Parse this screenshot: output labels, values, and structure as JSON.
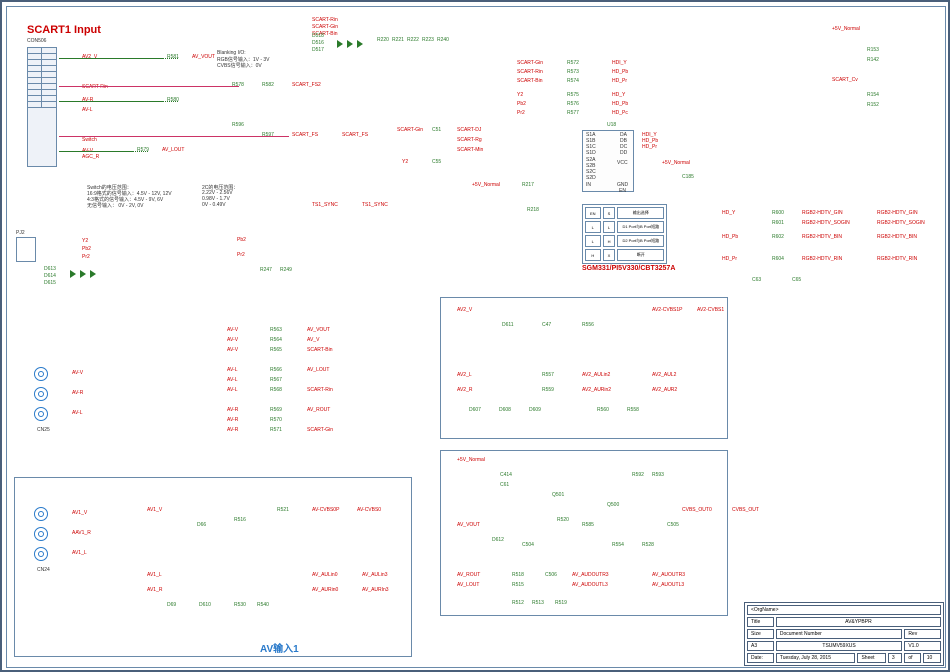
{
  "title": {
    "main": "SCART1 Input",
    "av_input": "AV输入1",
    "chip": "SGM331/PI5V330/CBT3257A"
  },
  "connectors": {
    "scart": "CON506",
    "rca_upper": "CN25",
    "rca_lower": "CN24",
    "pj2": "PJ2"
  },
  "notes": {
    "blanking": "Blanking I/O:",
    "blanking1": "RGB信号输入：1V - 3V",
    "blanking2": "CVBS信号输入：0V",
    "switch_title": "Switch的电压范围：",
    "switch1": "16:9格式的信号输入：4.5V - 12V, 12V",
    "switch2": "4:3格式的信号输入：4.5V - 9V, 6V",
    "switch3": "无信号输入：        0V - 2V, 0V",
    "vc_title": "2C的电压范围：",
    "vc1": "2.22V - 2.56V",
    "vc2": "0.98V - 1.7V",
    "vc3": "0V - 0.49V"
  },
  "nets": {
    "av2_v": "AV2_V",
    "scart_rin": "SCART-Rin",
    "av_vout": "AV_VOUT",
    "av_r": "AV-R",
    "av_l": "AV-L",
    "av_v": "AV-V",
    "switch": "Switch",
    "agc_r": "AGC_R",
    "av_lout": "AV_LOUT",
    "scart_gin": "SCART-Gin",
    "scart_bin": "SCART-Bin",
    "scart_fs2": "SCART_FS2",
    "scart_fs": "SCART_FS",
    "scart_dj": "SCART-DJ",
    "scart_rg": "SCART-Rg",
    "scart_min": "SCART-Min",
    "ts1_sync": "TS1_SYNC",
    "y2": "Y2",
    "pb2": "Pb2",
    "pr2": "Pr2",
    "hd_y": "HD_Y",
    "hd_pb": "HD_Pb",
    "hd_pr": "HD_Pr",
    "hd_pc": "HD_Pc",
    "hdi_y": "HDI_Y",
    "hdi_pb": "HDI_Pb",
    "hdi_pr": "HDI_Pr",
    "plus5v": "+5V_Normal",
    "plus5vn": "+5V_Normal",
    "scart_cv": "SCART_Cv",
    "rgb2_hdtv_gin": "RGB2-HDTV_GIN",
    "rgb2_hdtv_sogin": "RGB2-HDTV_SOGIN",
    "rgb2_hdtv_bin": "RGB2-HDTV_BIN",
    "rgb2_hdtv_rin": "RGB2-HDTV_RIN",
    "av2_cvbs1p": "AV2-CVBS1P",
    "av2_cvbs1": "AV2-CVBS1",
    "av2_aulin2": "AV2_AULin2",
    "av2_aurin2": "AV2_AURin2",
    "av2_aul2": "AV2_AUL2",
    "av2_aur2": "AV2_AUR2",
    "av2_l": "AV2_L",
    "av2_r": "AV2_R",
    "av_cvbs0p": "AV-CVBS0P",
    "av_cvbs0": "AV-CVBS0",
    "av1_v": "AV1_V",
    "aav1_r": "AAV1_R",
    "av1_l": "AV1_L",
    "av1_r": "AV1_R",
    "av_aulin0": "AV_AULin0",
    "av_aurin0": "AV_AURin0",
    "av_aulin3": "AV_AULin3",
    "av_aurin3": "AV_AURIn3",
    "av_rout": "AV_ROUT",
    "av_audoutr3": "AV_AUDOUTR3",
    "av_audoutl3": "AV_AUDOUTL3",
    "av_auoutr3": "AV_AUOUTR3",
    "av_auoutl3": "AV_AUOUTL3",
    "cvbs_out0": "CVBS_OUT0",
    "cvbs_out": "CVBS_OUT"
  },
  "components": {
    "r581": "R581",
    "r580": "R580",
    "r579": "R579",
    "r578": "R578",
    "r582": "R582",
    "r596": "R596",
    "r597": "R597",
    "r572": "R572",
    "r573": "R573",
    "r574": "R574",
    "r575": "R575",
    "r576": "R576",
    "r577": "R577",
    "r153": "R153",
    "r142": "R142",
    "r154": "R154",
    "r152": "R152",
    "r217": "R217",
    "r218": "R218",
    "r586": "R586",
    "r600": "R600",
    "r601": "R601",
    "r602": "R602",
    "r604": "R604",
    "r220": "R220",
    "r221": "R221",
    "r222": "R222",
    "r223": "R223",
    "r240": "R240",
    "r247": "R247",
    "r249": "R249",
    "r556": "R556",
    "r557": "R557",
    "r559": "R559",
    "r560": "R560",
    "r558": "R558",
    "r540": "R540",
    "r520": "R520",
    "r505": "R505",
    "r585": "R585",
    "r521": "R521",
    "r516": "R516",
    "r530": "R530",
    "r563": "R563",
    "r564": "R564",
    "r565": "R565",
    "r566": "R566",
    "r567": "R567",
    "r568": "R568",
    "r569": "R569",
    "r570": "R570",
    "r571": "R571",
    "r592": "R592",
    "r593": "R593",
    "r528": "R528",
    "r554": "R554",
    "r512": "R512",
    "r513": "R513",
    "r515": "R515",
    "r518": "R518",
    "r519": "R519",
    "d516": "D516",
    "d517": "D517",
    "d518": "D518",
    "d611": "D611",
    "d607": "D607",
    "d608": "D608",
    "d609": "D609",
    "d613": "D613",
    "d614": "D614",
    "d615": "D615",
    "d66": "D66",
    "d610": "D610",
    "d69": "D69",
    "d612": "D612",
    "c51": "C51",
    "c55": "C55",
    "c47": "C47",
    "c63": "C63",
    "c65": "C65",
    "c185": "C185",
    "c414": "C414",
    "c61": "C61",
    "c504": "C504",
    "c505": "C505",
    "c506": "C506",
    "u18": "U18",
    "q500": "Q500",
    "q501": "Q501"
  },
  "ic_pins": {
    "s1a": "S1A",
    "s1b": "S1B",
    "s1c": "S1C",
    "s1d": "S1D",
    "s2a": "S2A",
    "s2b": "S2B",
    "s2c": "S2C",
    "s2d": "S2D",
    "da": "DA",
    "db": "DB",
    "dc": "DC",
    "dd": "DD",
    "vcc": "VCC",
    "gnd": "GND",
    "en": "EN",
    "in": "IN"
  },
  "truth_table": {
    "header1": "EN",
    "header2": "S",
    "header3": "输出选择",
    "row1_1": "L",
    "row1_2": "L",
    "row1_3": "D1 Port与B Port短路",
    "row2_1": "L",
    "row2_2": "H",
    "row2_3": "D2 Port与B Port短路",
    "row3_1": "H",
    "row3_2": "X",
    "row3_3": "断开"
  },
  "middle_nets": {
    "av_vout2": "AV_VOUT",
    "av_v2": "AV_V",
    "scart_bin2": "SCART-Bin",
    "av_lout2": "AV_LOUT",
    "scart_rin2": "SCART-Rin",
    "av_rout2": "AV_ROUT",
    "scart_gin2": "SCART-Gin"
  },
  "title_block": {
    "org": "<OrgName>",
    "title_label": "Title",
    "title_value": "AV&YPBPR",
    "size_label": "Size",
    "size_value": "A3",
    "doc_label": "Document Number",
    "doc_value": "TSUMV59XUS",
    "rev_label": "Rev",
    "rev_value": "V1.0",
    "date_label": "Date:",
    "date_value": "Tuesday, July 28, 2015",
    "sheet_label": "Sheet",
    "sheet_value": "3",
    "of_label": "of",
    "of_value": "10"
  }
}
